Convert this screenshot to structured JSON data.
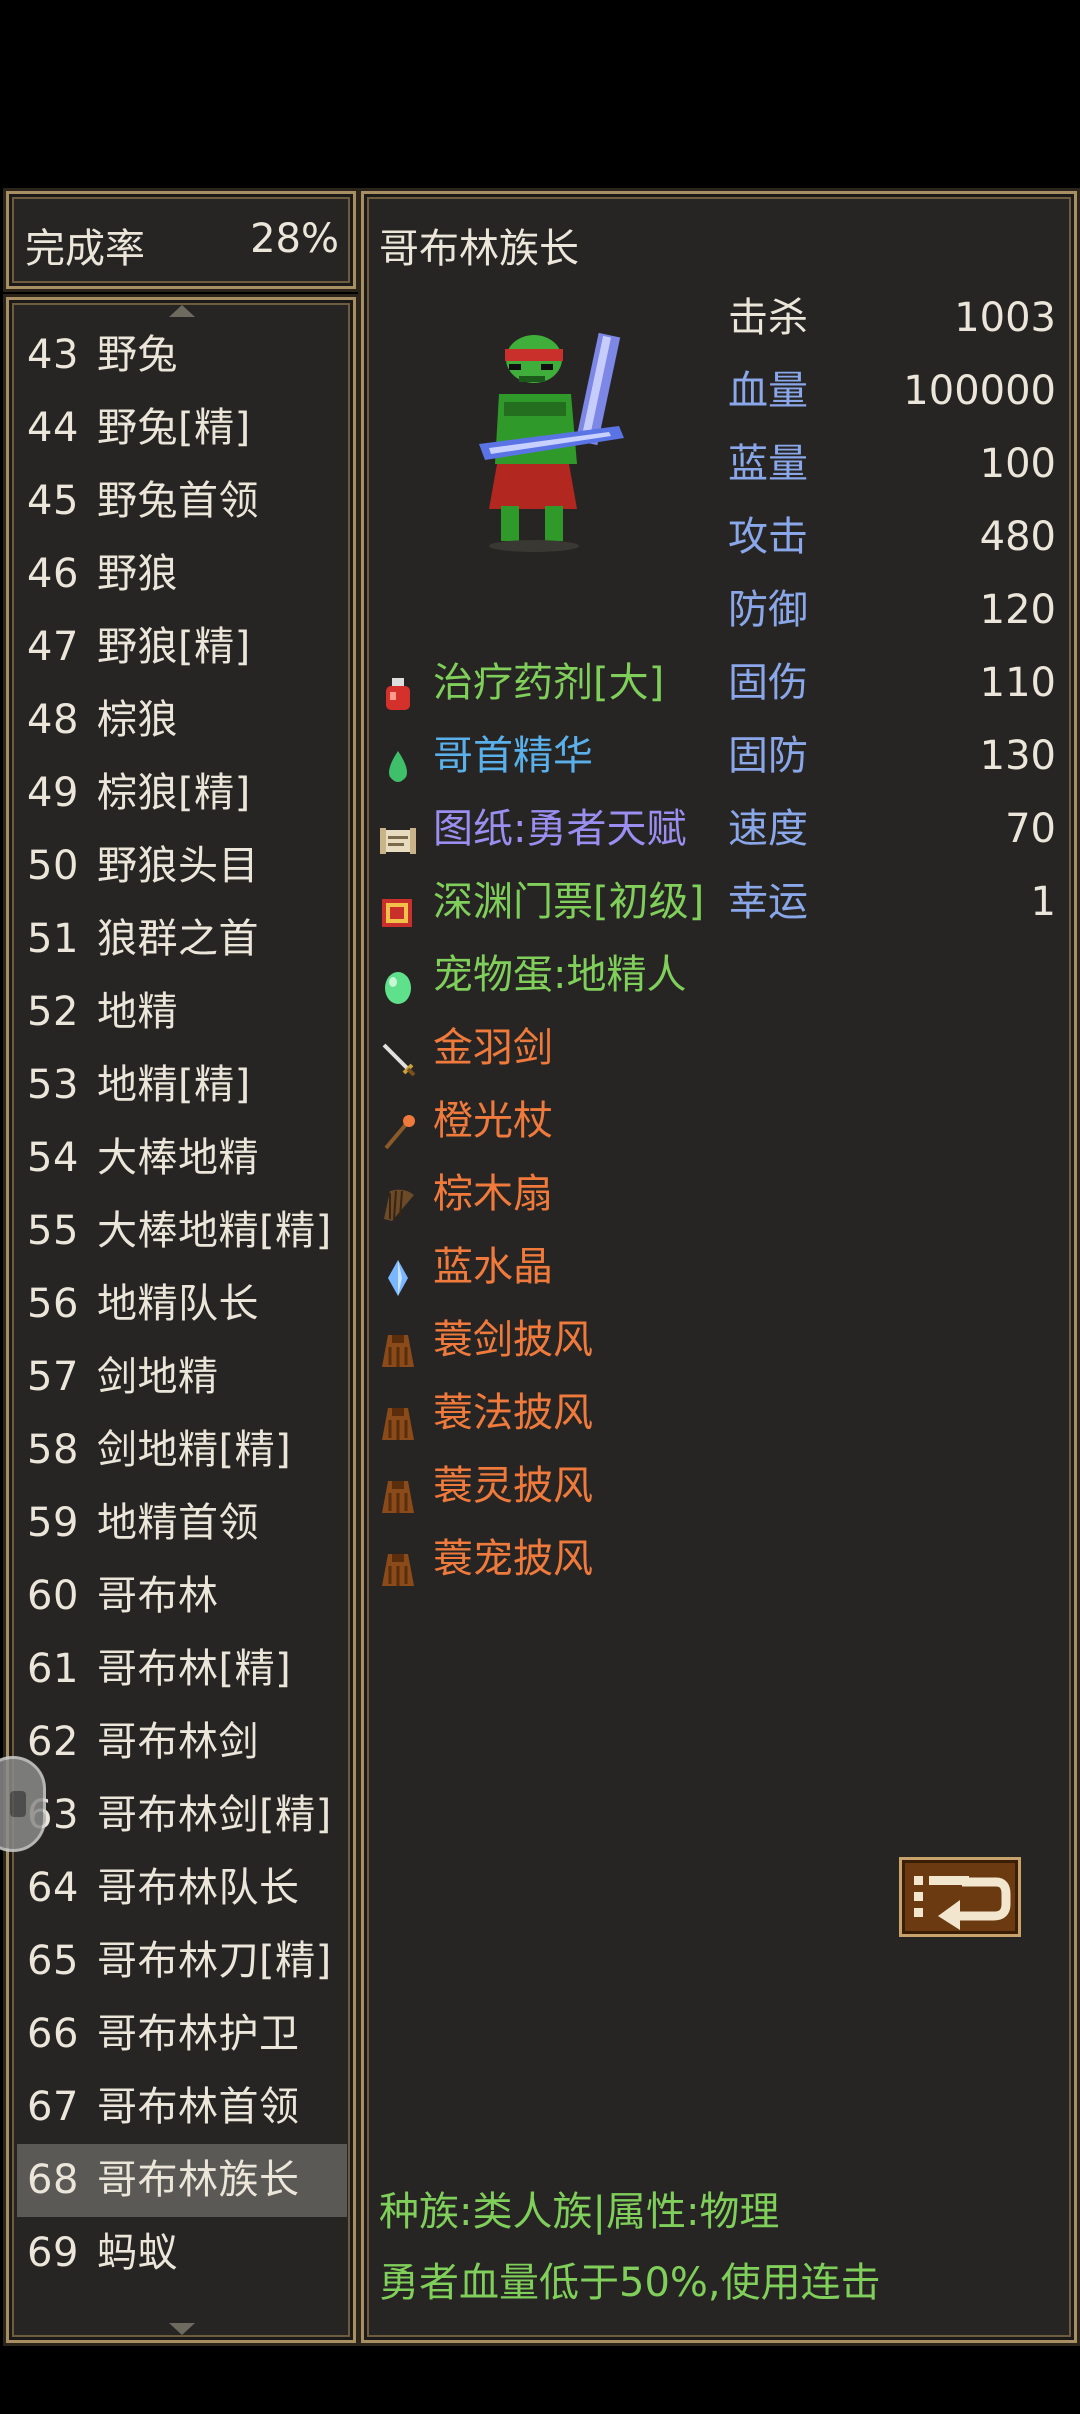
{
  "completion": {
    "label": "完成率",
    "value": "28%"
  },
  "monster_list": [
    {
      "num": "43",
      "name": "野兔"
    },
    {
      "num": "44",
      "name": "野兔[精]"
    },
    {
      "num": "45",
      "name": "野兔首领"
    },
    {
      "num": "46",
      "name": "野狼"
    },
    {
      "num": "47",
      "name": "野狼[精]"
    },
    {
      "num": "48",
      "name": "棕狼"
    },
    {
      "num": "49",
      "name": "棕狼[精]"
    },
    {
      "num": "50",
      "name": "野狼头目"
    },
    {
      "num": "51",
      "name": "狼群之首"
    },
    {
      "num": "52",
      "name": "地精"
    },
    {
      "num": "53",
      "name": "地精[精]"
    },
    {
      "num": "54",
      "name": "大棒地精"
    },
    {
      "num": "55",
      "name": "大棒地精[精]"
    },
    {
      "num": "56",
      "name": "地精队长"
    },
    {
      "num": "57",
      "name": "剑地精"
    },
    {
      "num": "58",
      "name": "剑地精[精]"
    },
    {
      "num": "59",
      "name": "地精首领"
    },
    {
      "num": "60",
      "name": "哥布林"
    },
    {
      "num": "61",
      "name": "哥布林[精]"
    },
    {
      "num": "62",
      "name": "哥布林剑"
    },
    {
      "num": "63",
      "name": "哥布林剑[精]"
    },
    {
      "num": "64",
      "name": "哥布林队长"
    },
    {
      "num": "65",
      "name": "哥布林刀[精]"
    },
    {
      "num": "66",
      "name": "哥布林护卫"
    },
    {
      "num": "67",
      "name": "哥布林首领"
    },
    {
      "num": "68",
      "name": "哥布林族长"
    },
    {
      "num": "69",
      "name": "蚂蚁"
    }
  ],
  "selected_index": 25,
  "detail": {
    "name": "哥布林族长",
    "stats": [
      {
        "label": "击杀",
        "value": "1003"
      },
      {
        "label": "血量",
        "value": "100000"
      },
      {
        "label": "蓝量",
        "value": "100"
      },
      {
        "label": "攻击",
        "value": "480"
      },
      {
        "label": "防御",
        "value": "120"
      },
      {
        "label": "固伤",
        "value": "110"
      },
      {
        "label": "固防",
        "value": "130"
      },
      {
        "label": "速度",
        "value": "70"
      },
      {
        "label": "幸运",
        "value": "1"
      }
    ],
    "drops": [
      {
        "name": "治疗药剂[大]",
        "color": "#7fcf5a",
        "icon": "potion-icon"
      },
      {
        "name": "哥首精华",
        "color": "#5ab0ea",
        "icon": "essence-icon"
      },
      {
        "name": "图纸:勇者天赋",
        "color": "#9a8ff0",
        "icon": "scroll-icon"
      },
      {
        "name": "深渊门票[初级]",
        "color": "#7fcf5a",
        "icon": "ticket-icon"
      },
      {
        "name": "宠物蛋:地精人",
        "color": "#7fcf5a",
        "icon": "egg-icon"
      },
      {
        "name": "金羽剑",
        "color": "#f07a3c",
        "icon": "sword-icon"
      },
      {
        "name": "橙光杖",
        "color": "#f07a3c",
        "icon": "staff-icon"
      },
      {
        "name": "棕木扇",
        "color": "#f07a3c",
        "icon": "fan-icon"
      },
      {
        "name": "蓝水晶",
        "color": "#f07a3c",
        "icon": "crystal-icon"
      },
      {
        "name": "蓑剑披风",
        "color": "#f07a3c",
        "icon": "cloak-icon"
      },
      {
        "name": "蓑法披风",
        "color": "#f07a3c",
        "icon": "cloak-icon"
      },
      {
        "name": "蓑灵披风",
        "color": "#f07a3c",
        "icon": "cloak-icon"
      },
      {
        "name": "蓑宠披风",
        "color": "#f07a3c",
        "icon": "cloak-icon"
      }
    ],
    "race_line": "种族:类人族|属性:物理",
    "hint_line": "勇者血量低于50%,使用连击"
  }
}
